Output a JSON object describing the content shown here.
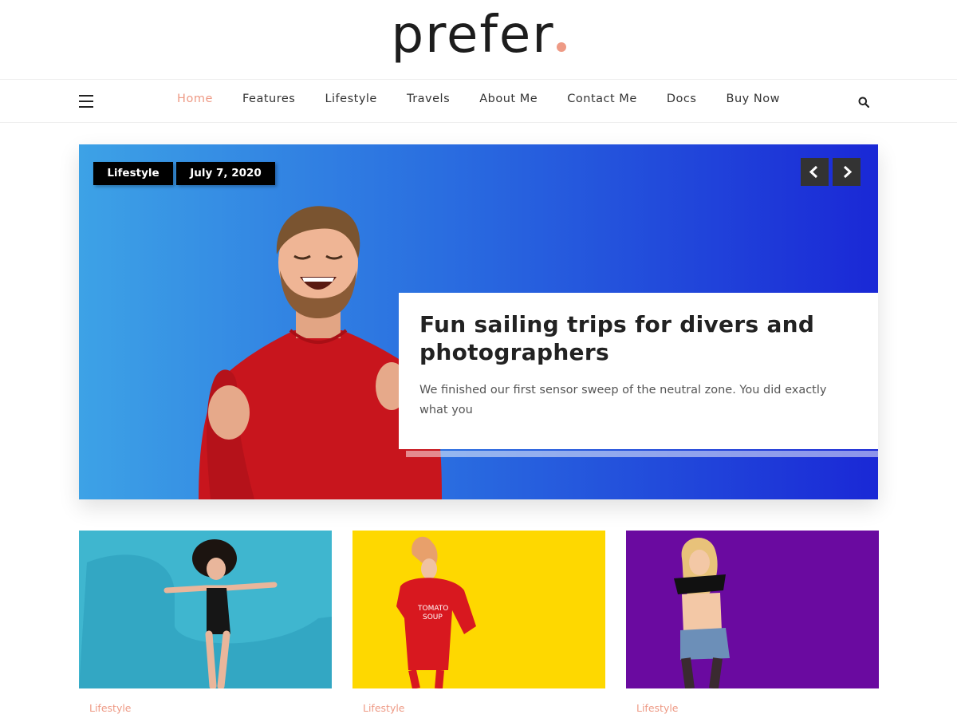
{
  "site": {
    "logo_text": "prefer"
  },
  "nav": {
    "items": [
      {
        "label": "Home",
        "active": true
      },
      {
        "label": "Features",
        "active": false
      },
      {
        "label": "Lifestyle",
        "active": false
      },
      {
        "label": "Travels",
        "active": false
      },
      {
        "label": "About Me",
        "active": false
      },
      {
        "label": "Contact Me",
        "active": false
      },
      {
        "label": "Docs",
        "active": false
      },
      {
        "label": "Buy Now",
        "active": false
      }
    ],
    "menu_icon": "hamburger-icon",
    "search_icon": "search-icon"
  },
  "hero": {
    "category": "Lifestyle",
    "date": "July 7, 2020",
    "title": "Fun sailing trips for divers and photographers",
    "excerpt": "We finished our first sensor sweep of the neutral zone. You did exactly what you",
    "prev_icon": "chevron-left-icon",
    "next_icon": "chevron-right-icon"
  },
  "posts": [
    {
      "category": "Lifestyle",
      "bg_color": "#3fb0c9"
    },
    {
      "category": "Lifestyle",
      "bg_color": "#fed800"
    },
    {
      "category": "Lifestyle",
      "bg_color": "#6a0aa0"
    }
  ],
  "colors": {
    "accent": "#ee9a85",
    "hero_gradient_start": "#3da2e6",
    "hero_gradient_end": "#1a28d6"
  }
}
